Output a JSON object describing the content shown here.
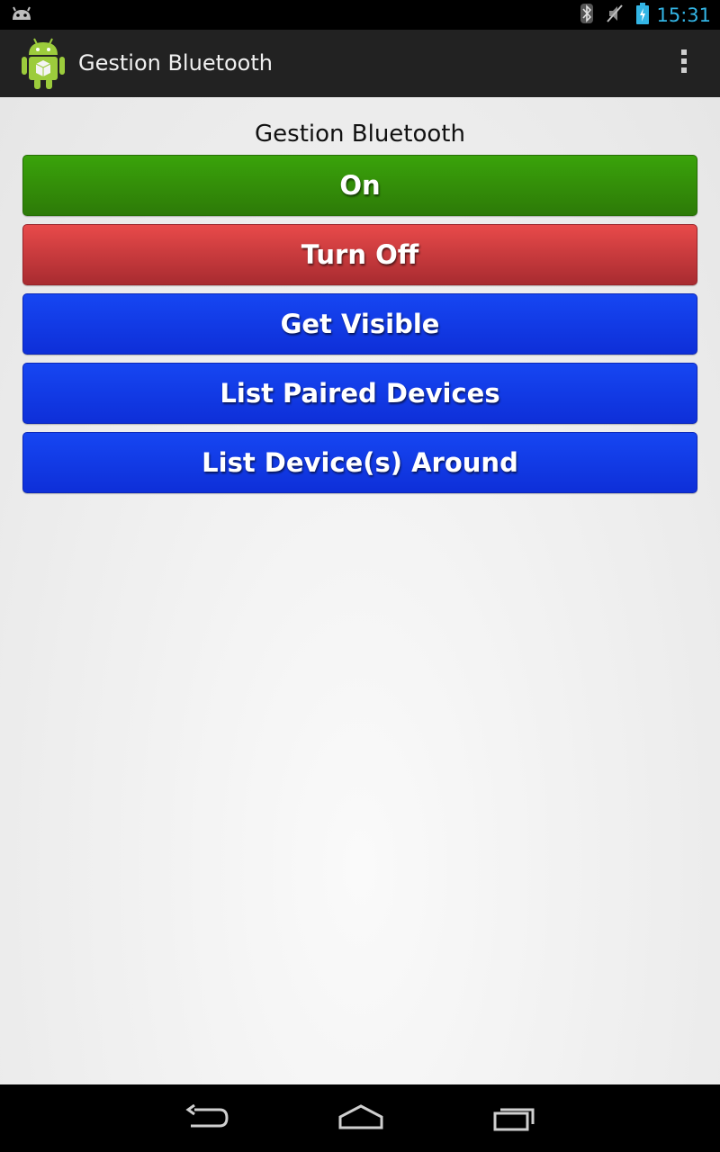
{
  "status_bar": {
    "time": "15:31",
    "left_icons": [
      "android-notification-icon"
    ],
    "right_icons": [
      "bluetooth-icon",
      "no-sound-icon",
      "battery-charging-icon"
    ],
    "accent": "#33b5e5"
  },
  "action_bar": {
    "title": "Gestion Bluetooth",
    "icons": [
      "app-android-icon",
      "overflow-menu-icon"
    ]
  },
  "main": {
    "heading": "Gestion Bluetooth",
    "buttons": [
      {
        "label": "On",
        "color": "#2f8a08"
      },
      {
        "label": "Turn Off",
        "color": "#c93a3d"
      },
      {
        "label": "Get Visible",
        "color": "#1239e6"
      },
      {
        "label": "List Paired Devices",
        "color": "#1239e6"
      },
      {
        "label": "List Device(s) Around",
        "color": "#1239e6"
      }
    ]
  },
  "nav_bar": {
    "icons": [
      "back-icon",
      "home-icon",
      "recent-apps-icon"
    ]
  }
}
